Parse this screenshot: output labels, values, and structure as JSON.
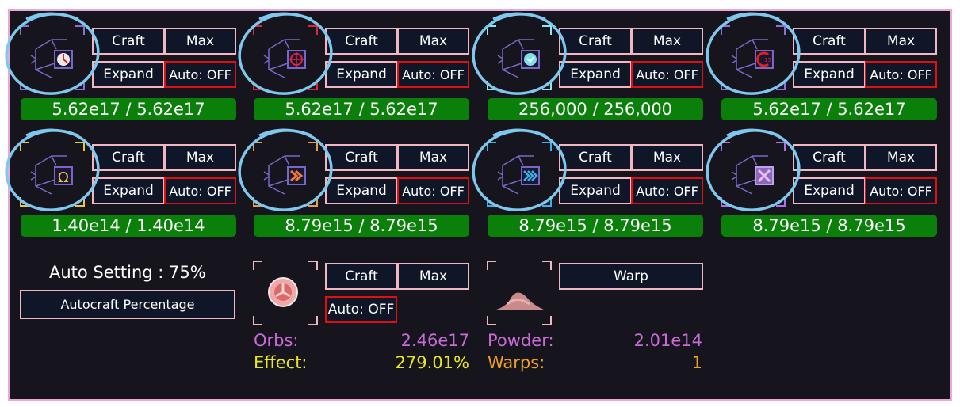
{
  "crafts": [
    {
      "name": "slot-1",
      "icon": "clock-icon",
      "accent": "#8a70d8",
      "craft": "Craft",
      "max": "Max",
      "expand": "Expand",
      "auto": "Auto: OFF",
      "progress": "5.62e17 / 5.62e17"
    },
    {
      "name": "slot-2",
      "icon": "crosshair-icon",
      "accent": "#e0243a",
      "craft": "Craft",
      "max": "Max",
      "expand": "Expand",
      "auto": "Auto: OFF",
      "progress": "5.62e17 / 5.62e17"
    },
    {
      "name": "slot-3",
      "icon": "cyan-orb-icon",
      "accent": "#8fe8e8",
      "craft": "Craft",
      "max": "Max",
      "expand": "Expand",
      "auto": "Auto: OFF",
      "progress": "256,000 / 256,000"
    },
    {
      "name": "slot-4",
      "icon": "c15-icon",
      "accent": "#8a70d8",
      "craft": "Craft",
      "max": "Max",
      "expand": "Expand",
      "auto": "Auto: OFF",
      "progress": "5.62e17 / 5.62e17"
    },
    {
      "name": "slot-5",
      "icon": "omega-icon",
      "accent": "#e8c840",
      "craft": "Craft",
      "max": "Max",
      "expand": "Expand",
      "auto": "Auto: OFF",
      "progress": "1.40e14 / 1.40e14"
    },
    {
      "name": "slot-6",
      "icon": "orange-chevron-icon",
      "accent": "#f29a4a",
      "craft": "Craft",
      "max": "Max",
      "expand": "Expand",
      "auto": "Auto: OFF",
      "progress": "8.79e15 / 8.79e15"
    },
    {
      "name": "slot-7",
      "icon": "blue-chevron-icon",
      "accent": "#3ab0f0",
      "craft": "Craft",
      "max": "Max",
      "expand": "Expand",
      "auto": "Auto: OFF",
      "progress": "8.79e15 / 8.79e15"
    },
    {
      "name": "slot-8",
      "icon": "x-cross-icon",
      "accent": "#b070e8",
      "craft": "Craft",
      "max": "Max",
      "expand": "Expand",
      "auto": "Auto: OFF",
      "progress": "8.79e15 / 8.79e15"
    }
  ],
  "auto_setting": {
    "label": "Auto Setting : 75%",
    "button": "Autocraft Percentage"
  },
  "orbs": {
    "craft": "Craft",
    "max": "Max",
    "auto": "Auto: OFF",
    "orbs_label": "Orbs:",
    "orbs_value": "2.46e17",
    "effect_label": "Effect:",
    "effect_value": "279.01%"
  },
  "powder": {
    "warp": "Warp",
    "powder_label": "Powder:",
    "powder_value": "2.01e14",
    "warps_label": "Warps:",
    "warps_value": "1"
  },
  "colors": {
    "panel_bg": "#16141d",
    "panel_border": "#e8a8d8",
    "button_border": "#f2b6c0",
    "auto_border": "#e01010",
    "progress": "#0a7f0a",
    "orbs": "#c86ad8",
    "effect": "#e8e820",
    "warps": "#f0a020",
    "annotation": "#7ec8ee"
  }
}
